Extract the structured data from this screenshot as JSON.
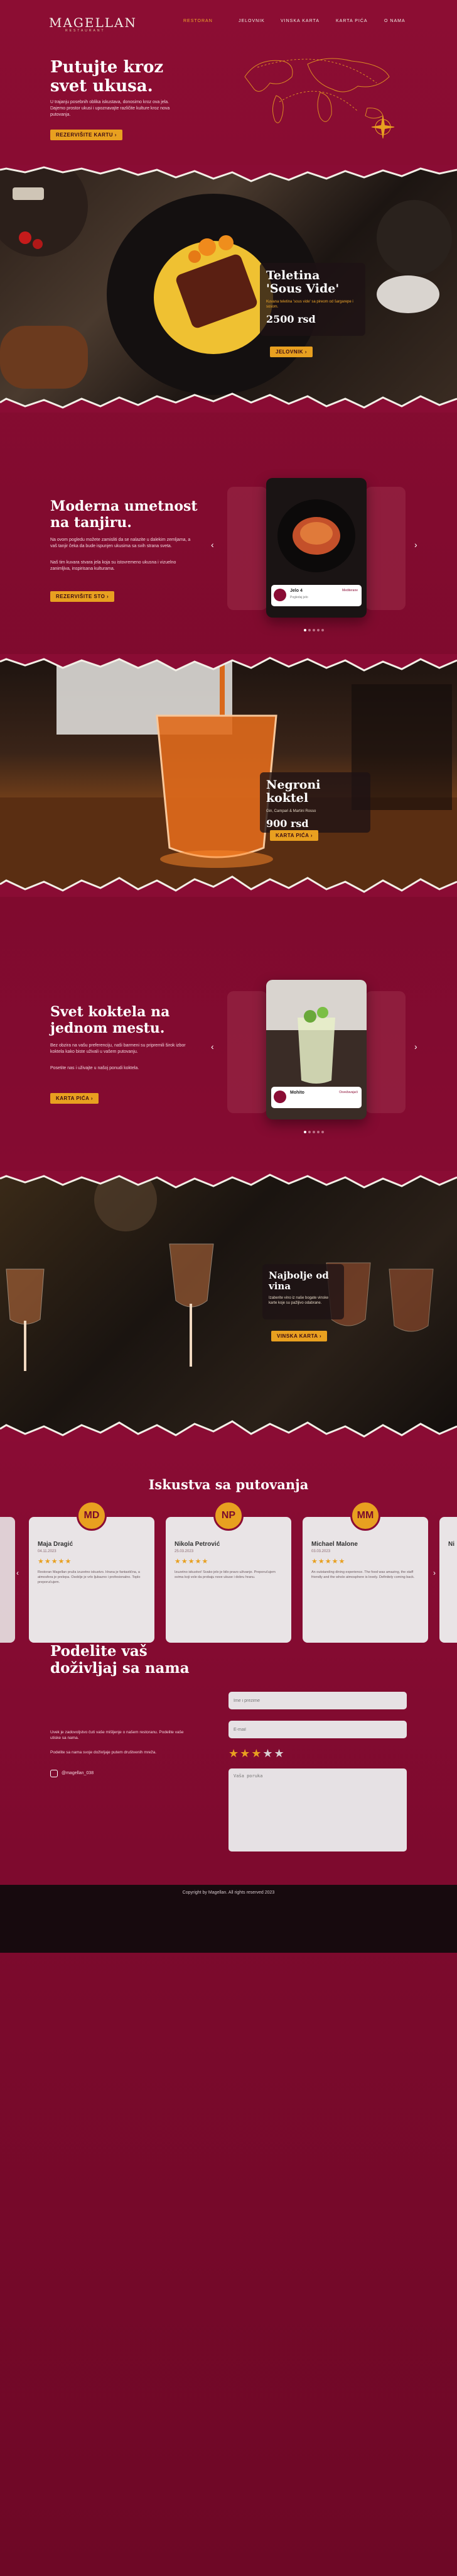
{
  "nav": {
    "logo": "MAGELLAN",
    "logo_sub": "RESTAURANT",
    "links": [
      "Restoran",
      "Jelovnik",
      "Vinska karta",
      "Karta pića",
      "O nama"
    ]
  },
  "hero": {
    "title": "Putujte kroz svet ukusa.",
    "text": "U trajanju posebnih oblika iskustava, donosimo kroz ova jela. Dajemo prostor ukusi i upoznavajte različite kulture kroz nova putovanja.",
    "button": "Rezervišite kartu ›"
  },
  "dish": {
    "title": "Teletina 'Sous Vide'",
    "subtitle": "Kuvana teletina 'sous vide' sa pireom od šargarepe i sosom.",
    "price": "2500 rsd",
    "button": "Jelovnik ›"
  },
  "art": {
    "title": "Moderna umetnost na tanjiru.",
    "text1": "Na ovom pogledu možete zamisliti da se nalazite u dalekim zemljama, a vaš tanjir čeka da bude ispunjen ukusima sa svih strana sveta.",
    "text2": "Naš tim kuvara stvara jela koja su istovremeno ukusna i vizuelno zanimljiva, inspirisana kulturama.",
    "button": "Rezervišite sto ›",
    "card_title": "Jelo 4",
    "card_sub": "Pogledaj jelo",
    "card_label": "Mediterane"
  },
  "cocktail": {
    "title": "Negroni koktel",
    "subtitle": "Gin, Campari & Martini Rosso",
    "price": "900 rsd",
    "button": "Karta pića ›"
  },
  "cocktails": {
    "title": "Svet koktela na jednom mestu.",
    "text1": "Bez obzira na vašu preferenciju, naši barmeni su pripremili širok izbor koktela kako biste uživali u vašem putovanju.",
    "text2": "Posetite nas i uživajte u našoj ponudi koktela.",
    "button": "Karta pića ›",
    "card_title": "Mohito",
    "card_label": "Osvežavajući"
  },
  "wine": {
    "title": "Najbolje od vina",
    "text": "Izaberite vino iz naše bogate vinske karte koje su pažljivo odabrane.",
    "button": "Vinska karta ›"
  },
  "reviews": {
    "title": "Iskustva sa putovanja",
    "items": [
      {
        "initials": "MD",
        "name": "Maja Dragić",
        "date": "04.11.2023",
        "stars": "★★★★★",
        "text": "Restoran Magellan pruža izuzetno iskustvo. Hrana je fantastična, a atmosfera je prelepa. Osoblje je vrlo ljubazno i profesionalno. Toplo preporučujem."
      },
      {
        "initials": "NP",
        "name": "Nikola Petrović",
        "date": "25.03.2023",
        "stars": "★★★★★",
        "text": "Izuzetno iskustvo! Svako jelo je bilo pravo uživanje. Preporučujem svima koji vole da probaju nove ukuse i dobru hranu."
      },
      {
        "initials": "MM",
        "name": "Michael Malone",
        "date": "03.03.2023",
        "stars": "★★★★★",
        "text": "An outstanding dining experience. The food was amazing, the staff friendly and the whole atmosphere is lovely. Definitely coming back."
      }
    ],
    "partial_name": "Ni"
  },
  "form": {
    "title": "Podelite vaš doživljaj sa nama",
    "text1": "Uvek je zadovoljstvo čuti vaše mišljenje o našem restoranu. Podelite vaše utiske sa nama.",
    "text2": "Podelite sa nama svoje doživljaje putem društvenih mreža.",
    "social": "@magellan_038",
    "name_placeholder": "Ime i prezime",
    "email_placeholder": "E-mail",
    "rating": "★★★",
    "rating_rest": "★★",
    "message_placeholder": "Vaša poruka"
  },
  "footer": {
    "copyright": "Copyright by Magellan. All rights reserved 2023"
  },
  "colors": {
    "brand": "#8c0d33",
    "accent": "#e8a020",
    "footer": "#170a0e"
  }
}
